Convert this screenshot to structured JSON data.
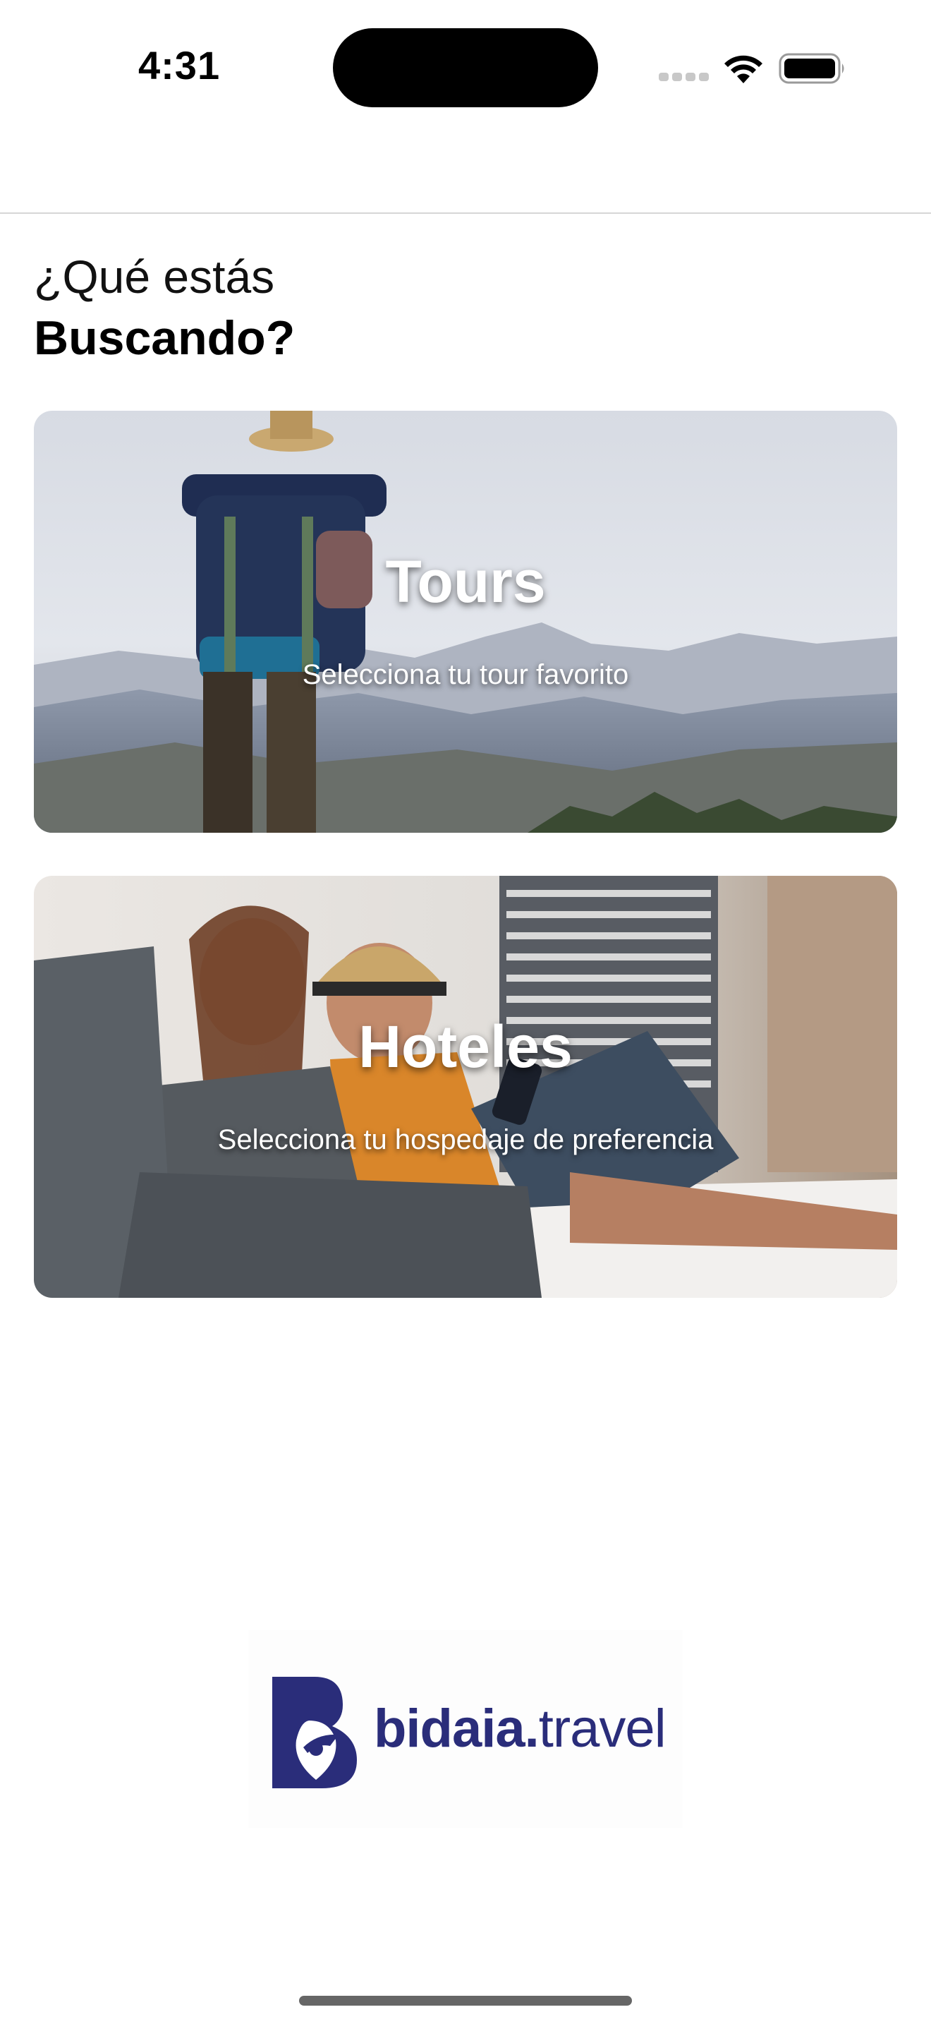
{
  "status_bar": {
    "time": "4:31",
    "icons": [
      "signal-icon",
      "wifi-icon",
      "battery-icon"
    ]
  },
  "heading": {
    "line1": "¿Qué estás",
    "line2": "Buscando?"
  },
  "cards": [
    {
      "id": "tours",
      "title": "Tours",
      "subtitle": "Selecciona tu tour favorito",
      "image": "backpacker-mountains-photo"
    },
    {
      "id": "hoteles",
      "title": "Hoteles",
      "subtitle": "Selecciona tu hospedaje de preferencia",
      "image": "couple-on-bed-photo"
    }
  ],
  "logo": {
    "brand_bold": "bidaia.",
    "brand_light": "travel",
    "color": "#2a2d7a"
  }
}
